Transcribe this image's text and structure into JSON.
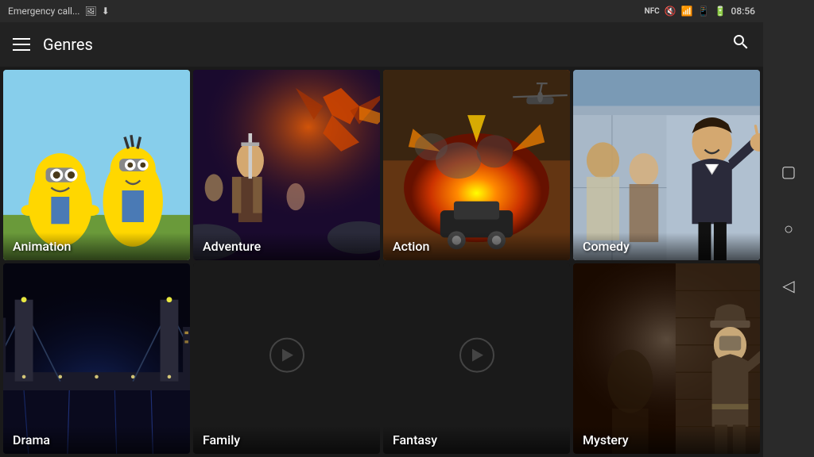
{
  "statusBar": {
    "leftText": "Emergency call...",
    "time": "08:56",
    "icons": [
      "image-icon",
      "download-icon",
      "nfc-icon",
      "mute-icon",
      "wifi-icon",
      "sim-icon",
      "battery-icon"
    ]
  },
  "topBar": {
    "title": "Genres",
    "searchLabel": "Search"
  },
  "sideNav": {
    "squareBtn": "□",
    "circleBtn": "○",
    "backBtn": "◁"
  },
  "genres": [
    {
      "id": "animation",
      "label": "Animation"
    },
    {
      "id": "adventure",
      "label": "Adventure"
    },
    {
      "id": "action",
      "label": "Action"
    },
    {
      "id": "comedy",
      "label": "Comedy"
    },
    {
      "id": "drama",
      "label": "Drama"
    },
    {
      "id": "family",
      "label": "Family"
    },
    {
      "id": "fantasy",
      "label": "Fantasy"
    },
    {
      "id": "mystery",
      "label": "Mystery"
    }
  ]
}
